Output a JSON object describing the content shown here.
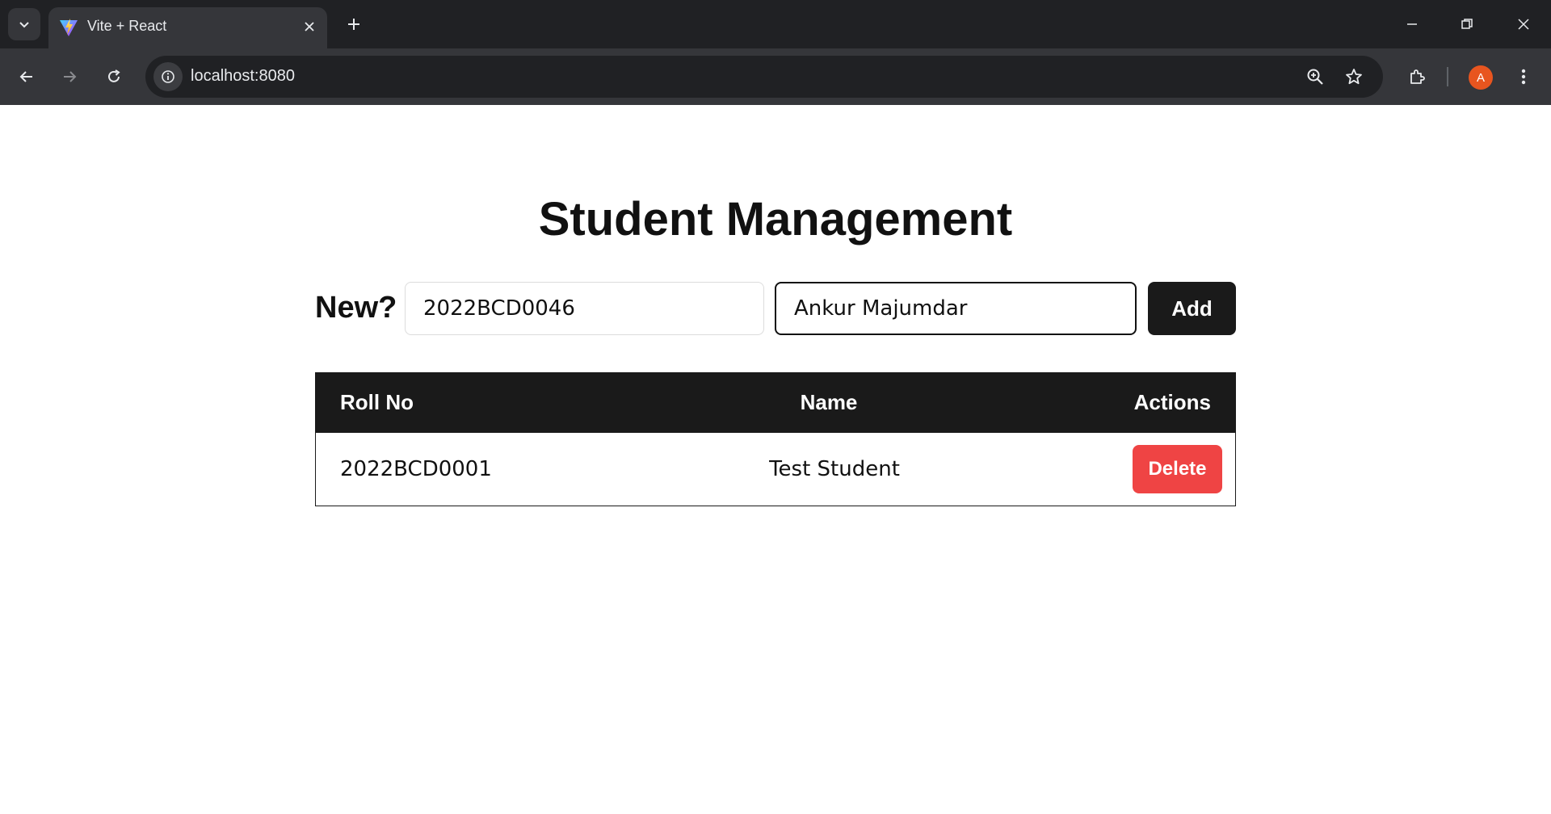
{
  "browser": {
    "tab_title": "Vite + React",
    "url": "localhost:8080",
    "profile_initial": "A",
    "icons": [
      "tab-list-icon",
      "vite-favicon-icon",
      "close-icon",
      "plus-icon",
      "minimize-icon",
      "restore-icon",
      "window-close-icon",
      "back-icon",
      "forward-icon",
      "reload-icon",
      "info-icon",
      "zoom-icon",
      "star-icon",
      "extensions-icon",
      "more-icon"
    ]
  },
  "app": {
    "title": "Student Management",
    "form": {
      "label": "New?",
      "roll_value": "2022BCD0046",
      "name_value": "Ankur Majumdar",
      "add_label": "Add"
    },
    "table": {
      "headers": [
        "Roll No",
        "Name",
        "Actions"
      ],
      "rows": [
        {
          "roll": "2022BCD0001",
          "name": "Test Student",
          "action": "Delete"
        }
      ]
    },
    "colors": {
      "primary": "#1a1a1a",
      "danger": "#ef4444"
    }
  }
}
